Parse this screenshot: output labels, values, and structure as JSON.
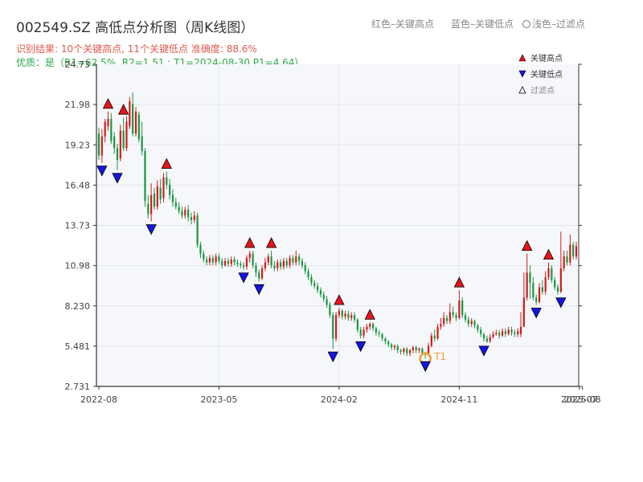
{
  "header": {
    "title": "002549.SZ 高低点分析图（周K线图）",
    "result_line": "识别结果: 10个关键高点, 11个关键低点  准确度: 88.6%",
    "quality_line": "优质：是（R1=62.5%, R2=1.51 ; T1=2024-08-30 P1=4.64）",
    "legend_red": "红色–关键高点",
    "legend_blue": "蓝色–关键低点",
    "legend_light": "浅色–过滤点"
  },
  "colors": {
    "up": "#d7191c",
    "down": "#1a9641",
    "high_marker": "#e8141b",
    "low_marker": "#1414e6",
    "highlight": "#f0a030",
    "plot_bg": "#f5f7fa"
  },
  "chart_data": {
    "type": "candlestick",
    "x_ticks": [
      "2022-08",
      "2023-05",
      "2024-02",
      "2024-11",
      "2025-07",
      "2025-08"
    ],
    "x_tick_positions": [
      0,
      39,
      78,
      117,
      156,
      157
    ],
    "y_ticks": [
      "2.731",
      "5.481",
      "8.230",
      "10.98",
      "13.73",
      "16.48",
      "19.23",
      "21.98",
      "24.73"
    ],
    "ylim": [
      2.731,
      24.73
    ],
    "legend": [
      {
        "label": "关键高点",
        "marker": "triangle-up",
        "color": "#e8141b"
      },
      {
        "label": "关键低点",
        "marker": "triangle-down",
        "color": "#1414e6"
      },
      {
        "label": "过滤点",
        "marker": "triangle-up-hollow",
        "color": "#888888"
      }
    ],
    "key_points": [
      {
        "type": "high",
        "x": 3,
        "price": 21.5
      },
      {
        "type": "high",
        "x": 8,
        "price": 21.1
      },
      {
        "type": "high",
        "x": 22,
        "price": 17.4
      },
      {
        "type": "high",
        "x": 49,
        "price": 12.0
      },
      {
        "type": "high",
        "x": 56,
        "price": 12.0
      },
      {
        "type": "high",
        "x": 78,
        "price": 8.1
      },
      {
        "type": "high",
        "x": 88,
        "price": 7.1
      },
      {
        "type": "high",
        "x": 117,
        "price": 9.3
      },
      {
        "type": "high",
        "x": 139,
        "price": 11.8
      },
      {
        "type": "high",
        "x": 146,
        "price": 11.2
      },
      {
        "type": "low",
        "x": 1,
        "price": 18.0
      },
      {
        "type": "low",
        "x": 6,
        "price": 17.5
      },
      {
        "type": "low",
        "x": 17,
        "price": 14.0
      },
      {
        "type": "low",
        "x": 47,
        "price": 10.7
      },
      {
        "type": "low",
        "x": 52,
        "price": 9.9
      },
      {
        "type": "low",
        "x": 76,
        "price": 5.3
      },
      {
        "type": "low",
        "x": 85,
        "price": 6.0
      },
      {
        "type": "low",
        "x": 106,
        "price": 4.64
      },
      {
        "type": "low",
        "x": 125,
        "price": 5.7
      },
      {
        "type": "low",
        "x": 142,
        "price": 8.3
      },
      {
        "type": "low",
        "x": 150,
        "price": 9.0
      }
    ],
    "highlight": {
      "x": 106,
      "price": 4.64,
      "label": "T1"
    },
    "candles": [
      [
        20.0,
        18.5,
        20.4,
        18.2
      ],
      [
        18.5,
        19.8,
        20.3,
        18.0
      ],
      [
        19.8,
        20.8,
        21.0,
        19.4
      ],
      [
        20.5,
        21.0,
        21.5,
        20.2
      ],
      [
        21.0,
        19.5,
        21.4,
        19.3
      ],
      [
        19.8,
        19.0,
        20.1,
        18.6
      ],
      [
        19.0,
        18.2,
        19.3,
        17.5
      ],
      [
        18.3,
        20.2,
        20.6,
        18.1
      ],
      [
        20.2,
        19.0,
        21.1,
        18.8
      ],
      [
        19.0,
        20.8,
        21.2,
        18.8
      ],
      [
        20.5,
        22.2,
        22.5,
        20.3
      ],
      [
        22.0,
        20.0,
        22.8,
        19.8
      ],
      [
        20.0,
        21.5,
        21.8,
        19.8
      ],
      [
        21.3,
        19.6,
        21.5,
        19.4
      ],
      [
        19.8,
        18.8,
        20.8,
        18.5
      ],
      [
        18.8,
        15.4,
        19.0,
        15.0
      ],
      [
        15.2,
        14.5,
        15.8,
        14.2
      ],
      [
        14.5,
        15.8,
        16.6,
        14.0
      ],
      [
        15.9,
        15.0,
        16.3,
        14.8
      ],
      [
        15.0,
        16.4,
        16.8,
        14.8
      ],
      [
        16.3,
        15.5,
        16.9,
        15.2
      ],
      [
        15.6,
        17.0,
        17.3,
        15.3
      ],
      [
        17.0,
        16.5,
        17.4,
        16.2
      ],
      [
        16.5,
        15.8,
        16.9,
        15.5
      ],
      [
        15.8,
        15.3,
        16.2,
        15.0
      ],
      [
        15.3,
        15.0,
        15.6,
        14.8
      ],
      [
        15.0,
        14.7,
        15.3,
        14.5
      ],
      [
        14.7,
        14.4,
        15.0,
        14.2
      ],
      [
        14.4,
        14.8,
        15.0,
        14.2
      ],
      [
        14.8,
        14.3,
        15.1,
        14.0
      ],
      [
        14.3,
        14.1,
        14.6,
        13.8
      ],
      [
        14.1,
        14.4,
        14.7,
        13.9
      ],
      [
        14.4,
        12.4,
        14.6,
        12.2
      ],
      [
        12.4,
        11.8,
        12.6,
        11.5
      ],
      [
        11.8,
        11.4,
        12.0,
        11.2
      ],
      [
        11.4,
        11.2,
        11.6,
        11.0
      ],
      [
        11.2,
        11.5,
        11.7,
        11.0
      ],
      [
        11.5,
        11.2,
        11.7,
        11.0
      ],
      [
        11.2,
        11.6,
        11.8,
        11.0
      ],
      [
        11.6,
        11.3,
        11.8,
        11.1
      ],
      [
        11.3,
        11.0,
        11.5,
        10.8
      ],
      [
        11.0,
        11.3,
        11.5,
        10.9
      ],
      [
        11.3,
        11.1,
        11.5,
        10.9
      ],
      [
        11.1,
        11.4,
        11.6,
        10.9
      ],
      [
        11.4,
        11.2,
        11.6,
        11.0
      ],
      [
        11.2,
        11.1,
        11.4,
        10.9
      ],
      [
        11.1,
        11.0,
        11.3,
        10.8
      ],
      [
        11.0,
        10.9,
        11.2,
        10.7
      ],
      [
        10.9,
        11.5,
        11.7,
        10.7
      ],
      [
        11.5,
        11.8,
        12.0,
        11.2
      ],
      [
        11.8,
        11.0,
        12.0,
        10.8
      ],
      [
        11.0,
        10.5,
        11.2,
        10.2
      ],
      [
        10.5,
        10.1,
        10.7,
        9.9
      ],
      [
        10.1,
        10.8,
        11.0,
        10.0
      ],
      [
        10.8,
        11.2,
        11.5,
        10.6
      ],
      [
        11.2,
        11.6,
        11.8,
        11.0
      ],
      [
        11.6,
        11.0,
        12.0,
        10.8
      ],
      [
        11.0,
        10.8,
        11.3,
        10.6
      ],
      [
        10.8,
        11.2,
        11.4,
        10.6
      ],
      [
        11.2,
        10.9,
        11.4,
        10.7
      ],
      [
        10.9,
        11.3,
        11.5,
        10.7
      ],
      [
        11.3,
        11.0,
        11.5,
        10.8
      ],
      [
        11.0,
        11.5,
        11.7,
        10.8
      ],
      [
        11.5,
        11.2,
        11.7,
        11.0
      ],
      [
        11.2,
        11.6,
        12.0,
        11.0
      ],
      [
        11.6,
        11.3,
        11.8,
        11.0
      ],
      [
        11.3,
        11.0,
        11.5,
        10.8
      ],
      [
        11.0,
        10.6,
        11.2,
        10.4
      ],
      [
        10.6,
        10.2,
        10.8,
        10.0
      ],
      [
        10.2,
        9.8,
        10.4,
        9.6
      ],
      [
        9.8,
        9.6,
        10.0,
        9.4
      ],
      [
        9.6,
        9.3,
        9.8,
        9.1
      ],
      [
        9.3,
        9.0,
        9.5,
        8.8
      ],
      [
        9.0,
        8.7,
        9.2,
        8.5
      ],
      [
        8.7,
        8.3,
        8.9,
        8.1
      ],
      [
        8.3,
        7.6,
        8.5,
        7.4
      ],
      [
        7.6,
        6.0,
        7.8,
        5.3
      ],
      [
        6.0,
        7.6,
        7.8,
        5.8
      ],
      [
        7.6,
        7.9,
        8.1,
        7.4
      ],
      [
        7.9,
        7.5,
        8.0,
        7.3
      ],
      [
        7.5,
        7.7,
        7.9,
        7.3
      ],
      [
        7.7,
        7.4,
        7.9,
        7.2
      ],
      [
        7.4,
        7.6,
        7.8,
        7.2
      ],
      [
        7.6,
        7.3,
        7.8,
        7.1
      ],
      [
        7.3,
        6.6,
        7.4,
        6.4
      ],
      [
        6.6,
        6.2,
        6.8,
        6.0
      ],
      [
        6.2,
        6.6,
        6.8,
        6.0
      ],
      [
        6.6,
        6.8,
        7.0,
        6.4
      ],
      [
        6.8,
        7.0,
        7.1,
        6.6
      ],
      [
        7.0,
        6.7,
        7.1,
        6.5
      ],
      [
        6.7,
        6.4,
        6.8,
        6.2
      ],
      [
        6.4,
        6.3,
        6.6,
        6.1
      ],
      [
        6.3,
        6.0,
        6.4,
        5.8
      ],
      [
        6.0,
        5.8,
        6.1,
        5.6
      ],
      [
        5.8,
        5.6,
        5.9,
        5.4
      ],
      [
        5.6,
        5.4,
        5.7,
        5.2
      ],
      [
        5.4,
        5.5,
        5.6,
        5.2
      ],
      [
        5.5,
        5.2,
        5.6,
        5.0
      ],
      [
        5.2,
        5.1,
        5.3,
        4.9
      ],
      [
        5.1,
        5.3,
        5.4,
        4.9
      ],
      [
        5.3,
        5.0,
        5.4,
        4.8
      ],
      [
        5.0,
        5.2,
        5.3,
        4.8
      ],
      [
        5.2,
        5.4,
        5.5,
        5.0
      ],
      [
        5.4,
        5.2,
        5.5,
        5.0
      ],
      [
        5.2,
        5.3,
        5.4,
        5.0
      ],
      [
        5.3,
        5.0,
        5.4,
        4.9
      ],
      [
        5.0,
        4.9,
        5.1,
        4.64
      ],
      [
        4.9,
        5.5,
        5.7,
        4.8
      ],
      [
        5.5,
        6.2,
        6.4,
        5.4
      ],
      [
        6.2,
        6.0,
        6.6,
        5.8
      ],
      [
        6.0,
        6.8,
        7.0,
        5.9
      ],
      [
        6.8,
        7.0,
        7.4,
        6.6
      ],
      [
        7.0,
        7.4,
        7.8,
        6.8
      ],
      [
        7.4,
        7.2,
        7.6,
        7.0
      ],
      [
        7.2,
        7.8,
        8.4,
        7.0
      ],
      [
        7.8,
        7.6,
        8.2,
        7.4
      ],
      [
        7.6,
        7.4,
        7.8,
        7.2
      ],
      [
        7.4,
        8.6,
        9.3,
        7.3
      ],
      [
        8.6,
        7.6,
        8.8,
        7.4
      ],
      [
        7.6,
        7.3,
        7.8,
        7.1
      ],
      [
        7.3,
        7.0,
        7.5,
        6.8
      ],
      [
        7.0,
        7.2,
        7.4,
        6.8
      ],
      [
        7.2,
        6.9,
        7.3,
        6.7
      ],
      [
        6.9,
        6.6,
        7.0,
        6.4
      ],
      [
        6.6,
        6.3,
        6.8,
        6.1
      ],
      [
        6.3,
        6.0,
        6.4,
        5.8
      ],
      [
        6.0,
        5.8,
        6.2,
        5.7
      ],
      [
        5.8,
        6.1,
        6.3,
        5.7
      ],
      [
        6.1,
        6.3,
        6.5,
        6.0
      ],
      [
        6.3,
        6.4,
        6.6,
        6.2
      ],
      [
        6.4,
        6.2,
        6.6,
        6.0
      ],
      [
        6.2,
        6.5,
        6.7,
        6.1
      ],
      [
        6.5,
        6.3,
        6.7,
        6.1
      ],
      [
        6.3,
        6.6,
        6.8,
        6.2
      ],
      [
        6.6,
        6.4,
        6.8,
        6.2
      ],
      [
        6.4,
        6.3,
        6.6,
        6.1
      ],
      [
        6.3,
        6.5,
        6.7,
        6.1
      ],
      [
        6.3,
        6.8,
        7.8,
        6.1
      ],
      [
        6.8,
        8.8,
        10.5,
        8.5
      ],
      [
        8.8,
        10.5,
        11.8,
        8.6
      ],
      [
        10.5,
        9.8,
        11.0,
        8.7
      ],
      [
        9.8,
        8.8,
        10.2,
        8.6
      ],
      [
        8.8,
        8.5,
        9.0,
        8.3
      ],
      [
        8.5,
        9.5,
        9.8,
        8.4
      ],
      [
        9.5,
        9.2,
        10.0,
        9.0
      ],
      [
        9.2,
        10.2,
        10.6,
        9.0
      ],
      [
        10.2,
        10.8,
        11.2,
        10.0
      ],
      [
        10.8,
        10.0,
        11.0,
        9.8
      ],
      [
        10.0,
        9.5,
        10.2,
        9.3
      ],
      [
        9.5,
        9.2,
        9.7,
        9.0
      ],
      [
        9.2,
        10.8,
        13.3,
        9.1
      ],
      [
        10.8,
        11.6,
        12.0,
        10.6
      ],
      [
        11.6,
        11.2,
        12.0,
        11.0
      ],
      [
        11.2,
        12.4,
        13.1,
        11.0
      ],
      [
        12.4,
        11.6,
        12.6,
        11.4
      ],
      [
        11.6,
        12.3,
        12.6,
        11.4
      ]
    ]
  }
}
